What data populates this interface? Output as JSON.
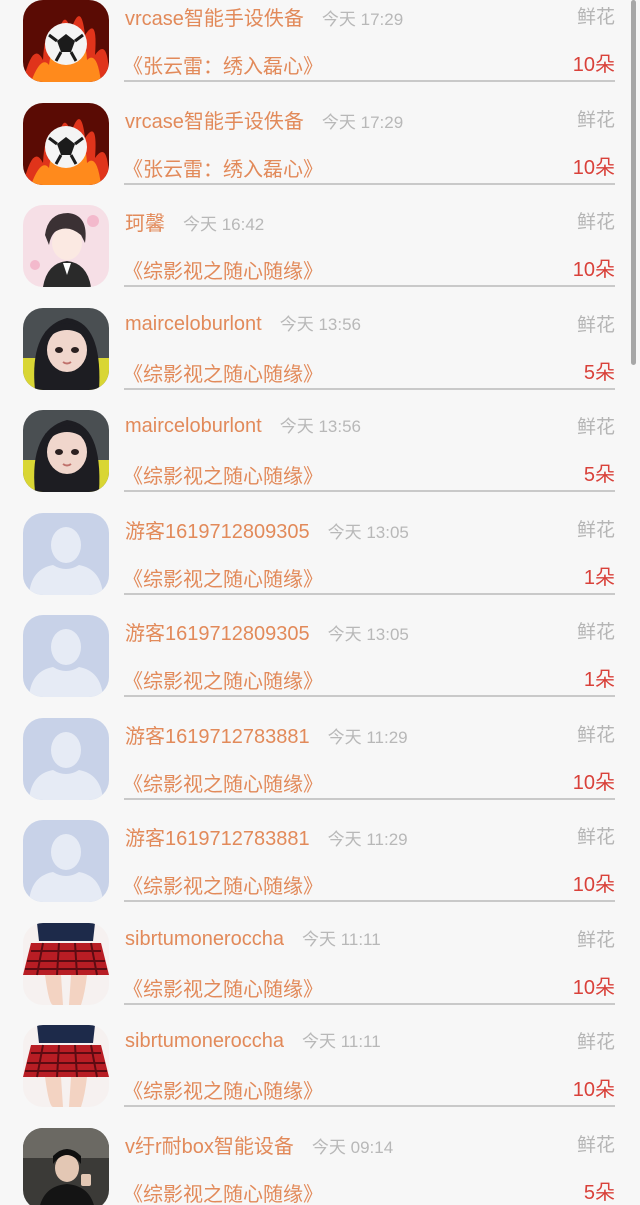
{
  "colors": {
    "name": "#e28a5a",
    "time": "#b8b8b8",
    "gift": "#b5b5b5",
    "count": "#d9413a"
  },
  "items": [
    {
      "name": "vrcase智能手设佚备",
      "time": "今天 17:29",
      "gift": "鲜花",
      "title": "《张云雷：绣入磊心》",
      "count": "10朵",
      "avatar": "football-fire-avatar"
    },
    {
      "name": "vrcase智能手设佚备",
      "time": "今天 17:29",
      "gift": "鲜花",
      "title": "《张云雷：绣入磊心》",
      "count": "10朵",
      "avatar": "football-fire-avatar"
    },
    {
      "name": "珂馨",
      "time": "今天 16:42",
      "gift": "鲜花",
      "title": "《综影视之随心随缘》",
      "count": "10朵",
      "avatar": "anime-boy-avatar"
    },
    {
      "name": "mairceloburlont",
      "time": "今天 13:56",
      "gift": "鲜花",
      "title": "《综影视之随心随缘》",
      "count": "5朵",
      "avatar": "girl-photo-avatar"
    },
    {
      "name": "mairceloburlont",
      "time": "今天 13:56",
      "gift": "鲜花",
      "title": "《综影视之随心随缘》",
      "count": "5朵",
      "avatar": "girl-photo-avatar"
    },
    {
      "name": "游客1619712809305",
      "time": "今天 13:05",
      "gift": "鲜花",
      "title": "《综影视之随心随缘》",
      "count": "1朵",
      "avatar": "default-user-avatar"
    },
    {
      "name": "游客1619712809305",
      "time": "今天 13:05",
      "gift": "鲜花",
      "title": "《综影视之随心随缘》",
      "count": "1朵",
      "avatar": "default-user-avatar"
    },
    {
      "name": "游客1619712783881",
      "time": "今天 11:29",
      "gift": "鲜花",
      "title": "《综影视之随心随缘》",
      "count": "10朵",
      "avatar": "default-user-avatar"
    },
    {
      "name": "游客1619712783881",
      "time": "今天 11:29",
      "gift": "鲜花",
      "title": "《综影视之随心随缘》",
      "count": "10朵",
      "avatar": "default-user-avatar"
    },
    {
      "name": "sibrtumoneroccha",
      "time": "今天 11:11",
      "gift": "鲜花",
      "title": "《综影视之随心随缘》",
      "count": "10朵",
      "avatar": "plaid-skirt-avatar"
    },
    {
      "name": "sibrtumoneroccha",
      "time": "今天 11:11",
      "gift": "鲜花",
      "title": "《综影视之随心随缘》",
      "count": "10朵",
      "avatar": "plaid-skirt-avatar"
    },
    {
      "name": "v纡r耐box智能设备",
      "time": "今天 09:14",
      "gift": "鲜花",
      "title": "《综影视之随心随缘》",
      "count": "5朵",
      "avatar": "dark-portrait-avatar"
    }
  ]
}
